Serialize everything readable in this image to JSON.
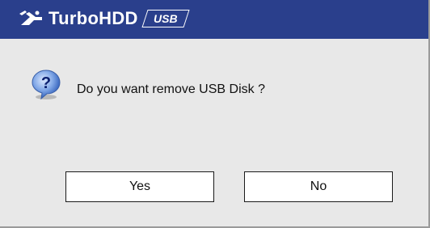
{
  "titlebar": {
    "brand": "TurboHDD",
    "badge": "USB",
    "logo_icon": "turbo-swoosh-icon",
    "bg_color": "#2a3f8c"
  },
  "dialog": {
    "icon": "question-icon",
    "message": "Do you want remove USB Disk ?",
    "bg_color": "#e8e8e8"
  },
  "buttons": {
    "yes_label": "Yes",
    "no_label": "No"
  }
}
